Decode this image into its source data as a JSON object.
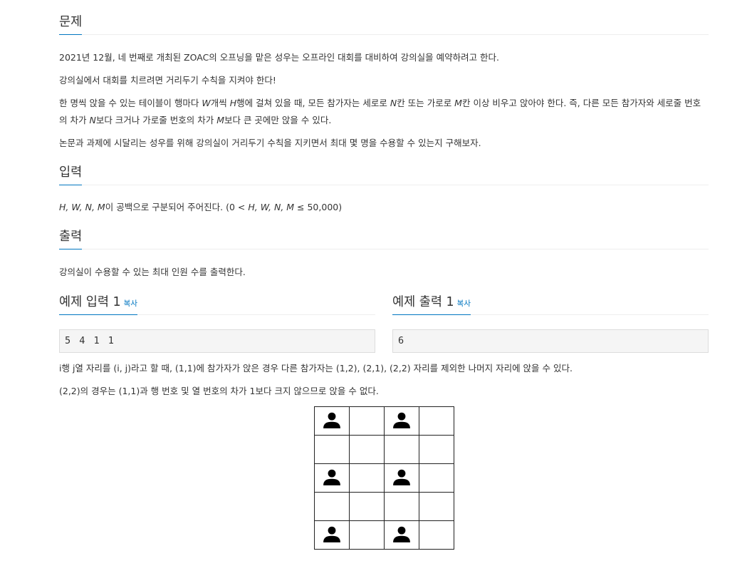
{
  "problem": {
    "heading": "문제",
    "p1": "2021년 12월, 네 번째로 개최된 ZOAC의 오프닝을 맡은 성우는 오프라인 대회를 대비하여 강의실을 예약하려고 한다.",
    "p2": "강의실에서 대회를 치르려면 거리두기 수칙을 지켜야 한다!",
    "p3": {
      "t1": "한 명씩 앉을 수 있는 테이블이 행마다 ",
      "v1": "W",
      "t2": "개씩 ",
      "v2": "H",
      "t3": "행에 걸쳐 있을 때, 모든 참가자는 세로로 ",
      "v3": "N",
      "t4": "칸 또는 가로로 ",
      "v4": "M",
      "t5": "칸 이상 비우고 앉아야 한다. 즉, 다른 모든 참가자와 세로줄 번호의 차가 ",
      "v5": "N",
      "t6": "보다 크거나 가로줄 번호의 차가 ",
      "v6": "M",
      "t7": "보다 큰 곳에만 앉을 수 있다."
    },
    "p4": "논문과 과제에 시달리는 성우를 위해 강의실이 거리두기 수칙을 지키면서 최대 몇 명을 수용할 수 있는지 구해보자."
  },
  "input": {
    "heading": "입력",
    "vars": "H, W, N, M",
    "t1": "이 공백으로 구분되어 주어진다. (0 < ",
    "vars2": "H, W, N, M",
    "t2": " ≤ 50,000)"
  },
  "output": {
    "heading": "출력",
    "text": "강의실이 수용할 수 있는 최대 인원 수를 출력한다."
  },
  "samples": {
    "input_title": "예제 입력 1",
    "output_title": "예제 출력 1",
    "copy_label": "복사",
    "input_value": "5 4 1 1",
    "output_value": "6"
  },
  "explanation": {
    "p1": "i행 j열 자리를 (i, j)라고 할 때, (1,1)에 참가자가 앉은 경우 다른 참가자는 (1,2), (2,1), (2,2) 자리를 제외한 나머지 자리에 앉을 수 있다.",
    "p2": "(2,2)의 경우는 (1,1)과 행 번호 및 열 번호의 차가 1보다 크지 않으므로 앉을 수 없다."
  },
  "seating_grid": {
    "rows": [
      [
        1,
        0,
        1,
        0
      ],
      [
        0,
        0,
        0,
        0
      ],
      [
        1,
        0,
        1,
        0
      ],
      [
        0,
        0,
        0,
        0
      ],
      [
        1,
        0,
        1,
        0
      ]
    ],
    "icon": "person-icon"
  }
}
